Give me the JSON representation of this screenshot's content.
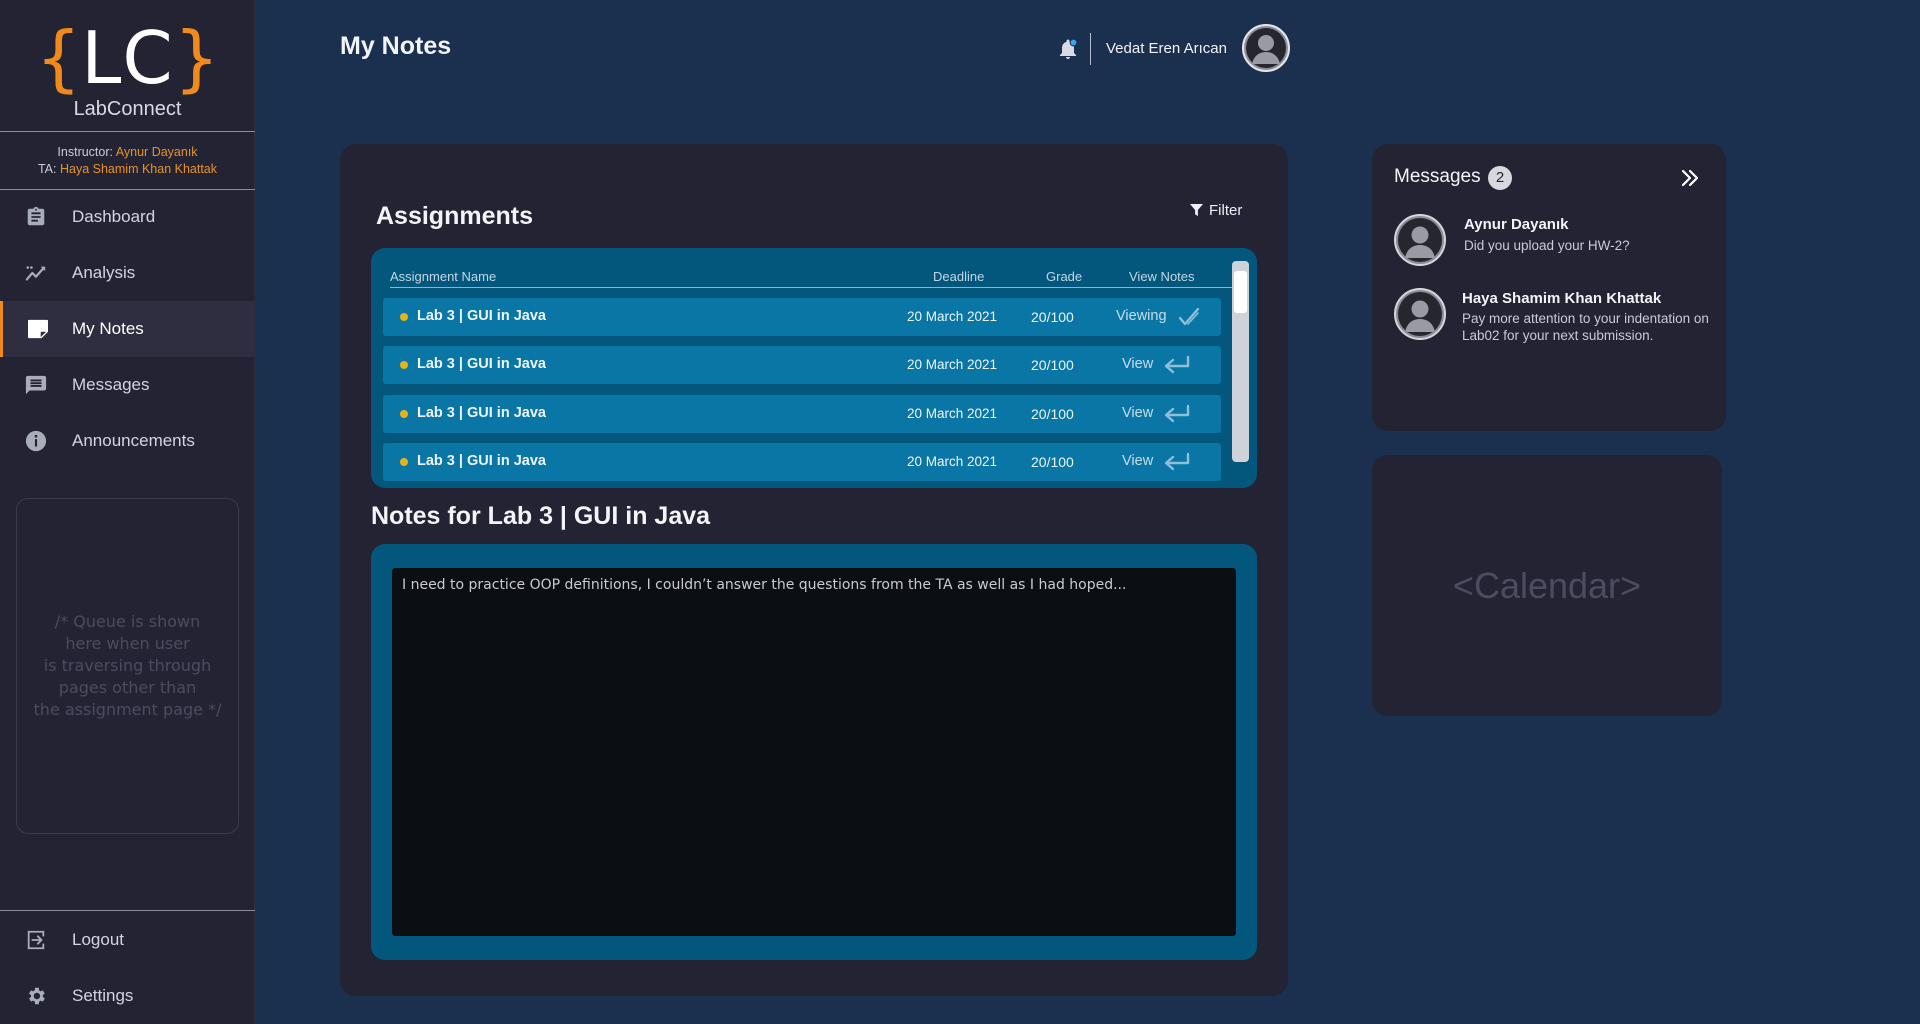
{
  "app": {
    "logo_open": "{",
    "logo_letters": "LC",
    "logo_close": "}",
    "name": "LabConnect"
  },
  "staff": {
    "instructor_label": "Instructor:",
    "instructor_name": "Aynur Dayanık",
    "ta_label": "TA:",
    "ta_name": "Haya Shamim Khan Khattak"
  },
  "nav": {
    "items": [
      {
        "label": "Dashboard",
        "icon": "clipboard-icon"
      },
      {
        "label": "Analysis",
        "icon": "trend-line-icon"
      },
      {
        "label": "My Notes",
        "icon": "note-icon",
        "active": true
      },
      {
        "label": "Messages",
        "icon": "chat-bubble-icon"
      },
      {
        "label": "Announcements",
        "icon": "info-icon"
      }
    ],
    "logout": "Logout",
    "settings": "Settings"
  },
  "queue_placeholder": "/* Queue is shown\nhere when user\nis traversing through\npages other than\nthe assignment page */",
  "header": {
    "title": "My Notes",
    "user_name": "Vedat Eren Arıcan"
  },
  "assignments": {
    "title": "Assignments",
    "filter_label": "Filter",
    "columns": {
      "name": "Assignment Name",
      "deadline": "Deadline",
      "grade": "Grade",
      "view_notes": "View Notes"
    },
    "rows": [
      {
        "name": "Lab 3 | GUI in Java",
        "deadline": "20 March 2021",
        "grade": "20/100",
        "view": "Viewing",
        "state": "viewing"
      },
      {
        "name": "Lab 3 | GUI in Java",
        "deadline": "20 March 2021",
        "grade": "20/100",
        "view": "View",
        "state": "view"
      },
      {
        "name": "Lab 3 | GUI in Java",
        "deadline": "20 March 2021",
        "grade": "20/100",
        "view": "View",
        "state": "view"
      },
      {
        "name": "Lab 3 | GUI in Java",
        "deadline": "20 March 2021",
        "grade": "20/100",
        "view": "View",
        "state": "view"
      }
    ]
  },
  "notes": {
    "title": "Notes for Lab 3 | GUI in Java",
    "content": "I need to practice OOP definitions, I couldn’t answer the questions from the TA as well as I had hoped..."
  },
  "messages": {
    "title": "Messages",
    "count": "2",
    "items": [
      {
        "from": "Aynur Dayanık",
        "text": "Did you upload  your  HW-2?"
      },
      {
        "from": "Haya Shamim Khan Khattak",
        "text": "Pay more attention to your indentation on Lab02 for your next submission."
      }
    ]
  },
  "calendar_placeholder": "<Calendar>",
  "colors": {
    "background": "#1b2f4f",
    "sidebar": "#232333",
    "accent_orange": "#f08a1c",
    "table_bg": "#03577d",
    "row_bg": "#0a76a6",
    "status_dot": "#e7b317"
  }
}
